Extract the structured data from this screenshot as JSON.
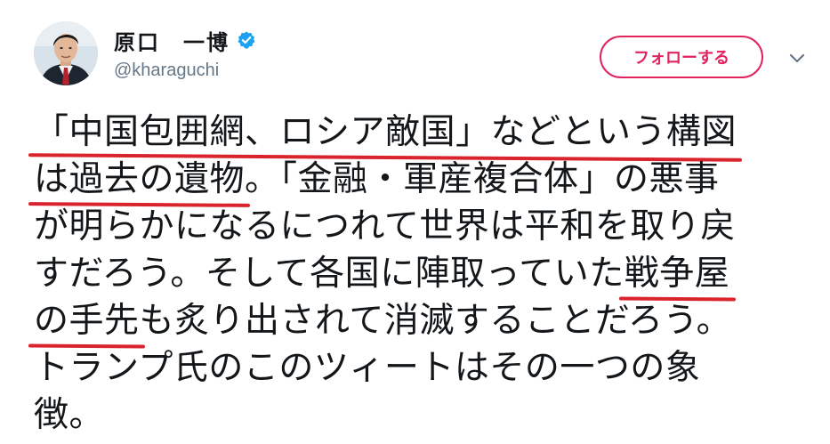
{
  "user": {
    "display_name": "原口　一博",
    "handle": "@kharaguchi",
    "verified": true
  },
  "actions": {
    "follow_label": "フォローする"
  },
  "icons": {
    "avatar": "profile-photo",
    "verified": "verified-badge-icon",
    "caret": "chevron-down-icon"
  },
  "colors": {
    "accent": "#e0245e",
    "verified": "#1da1f2",
    "underline": "#d9232d",
    "text": "#14171a",
    "secondary": "#657786"
  },
  "tweet": {
    "line1": {
      "underlined": "「中国包囲網、ロシア敵国」などという構図"
    },
    "line2": {
      "underlined": "は過去の遺物",
      "rest": "。「金融・軍産複合体」の悪事"
    },
    "line3": {
      "text": "が明らかになるにつれて世界は平和を取り戻"
    },
    "line4": {
      "text": "すだろう。そして各国に陣取っていた",
      "underlined": "戦争屋"
    },
    "line5": {
      "underlined": "の手先",
      "rest": "も炙り出されて消滅することだろう。"
    },
    "line6": {
      "text": "トランプ氏のこのツィートはその一つの象"
    },
    "line7": {
      "text": "徴。"
    }
  }
}
